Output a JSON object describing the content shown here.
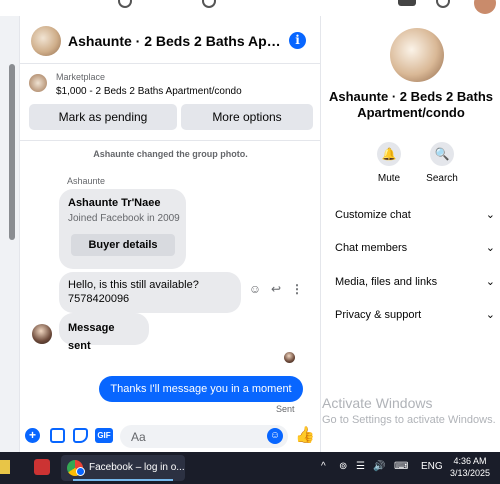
{
  "chat": {
    "title": "Ashaunte · 2 Beds 2 Baths Apartm…",
    "info_icon": "i",
    "marketplace": {
      "label": "Marketplace",
      "listing": "$1,000 - 2 Beds 2 Baths Apartment/condo",
      "mark_pending": "Mark as pending",
      "more_options": "More options"
    },
    "messages": {
      "system_notice": "Ashaunte changed the group photo.",
      "sender_name": "Ashaunte",
      "card": {
        "name": "Ashaunte Tr'Naee",
        "subtitle": "Joined Facebook in 2009",
        "button": "Buyer details"
      },
      "incoming_1": "Hello, is this still available? 7578420096",
      "incoming_2": "Message sent",
      "outgoing_1": "Thanks I'll message you in a moment",
      "sent_status": "Sent"
    },
    "composer": {
      "placeholder": "Aa",
      "gif_label": "GIF"
    }
  },
  "info_panel": {
    "title": "Ashaunte · 2 Beds 2 Baths Apartment/condo",
    "mute_label": "Mute",
    "search_label": "Search",
    "sections": [
      "Customize chat",
      "Chat members",
      "Media, files and links",
      "Privacy & support"
    ]
  },
  "watermark": {
    "line1": "Activate Windows",
    "line2": "Go to Settings to activate Windows."
  },
  "taskbar": {
    "chrome_label": "Facebook – log in o...",
    "language": "ENG",
    "time": "4:36 AM",
    "date": "3/13/2025"
  },
  "colors": {
    "accent": "#0866ff",
    "bubble_incoming": "#e9eaed",
    "taskbar": "#1a1d29"
  },
  "icons": [
    "info-icon",
    "bell-icon",
    "search-icon",
    "plus-icon",
    "image-icon",
    "sticker-icon",
    "gif-icon",
    "emoji-icon",
    "like-icon",
    "reaction-icon",
    "reply-icon",
    "more-icon",
    "chevron-down-icon"
  ]
}
